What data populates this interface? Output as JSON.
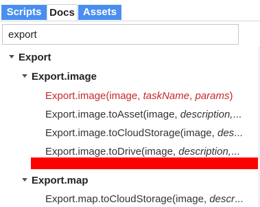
{
  "tabs": {
    "scripts": "Scripts",
    "docs": "Docs",
    "assets": "Assets"
  },
  "search": {
    "value": "export"
  },
  "tree": {
    "root": "Export",
    "group1": {
      "label": "Export.image",
      "items": [
        {
          "name": "Export.image(",
          "args": [
            [
              "image",
              ""
            ],
            [
              "taskName",
              "it"
            ],
            [
              "params",
              "it"
            ]
          ],
          "sep": ", ",
          "end": ")"
        },
        {
          "name": "Export.image.toAsset(",
          "arg1": "image, ",
          "arg2": "description,",
          "tail": "..."
        },
        {
          "name": "Export.image.toCloudStorage(",
          "arg1": "image, ",
          "arg2": "des",
          "tail": "..."
        },
        {
          "name": "Export.image.toDrive(",
          "arg1": "image, ",
          "arg2": "description,",
          "tail": "..."
        }
      ]
    },
    "group2": {
      "label": "Export.map",
      "items": [
        {
          "name": "Export.map.toCloudStorage(",
          "arg1": "image, ",
          "arg2": "descr",
          "tail": "..."
        }
      ]
    }
  },
  "colors": {
    "accent": "#4a8ef0",
    "highlight": "#c62828",
    "redaction": "#ff0000"
  }
}
